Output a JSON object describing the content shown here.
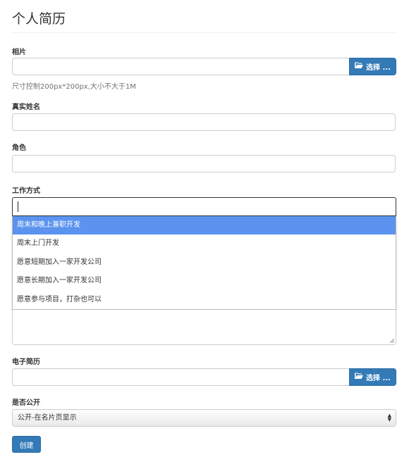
{
  "page": {
    "title": "个人简历"
  },
  "photo": {
    "label": "相片",
    "browse_label": "选择 ...",
    "help": "尺寸控制200px*200px,大小不大于1M"
  },
  "real_name": {
    "label": "真实姓名",
    "value": ""
  },
  "role": {
    "label": "角色",
    "value": ""
  },
  "work_mode": {
    "label": "工作方式",
    "value": "",
    "options": [
      "周末和晚上兼职开发",
      "周末上门开发",
      "愿意短期加入一家开发公司",
      "愿意长期加入一家开发公司",
      "愿意参与项目，打杂也可以"
    ],
    "highlighted_index": 0
  },
  "resume": {
    "label": "电子简历",
    "browse_label": "选择 ..."
  },
  "public": {
    "label": "是否公开",
    "selected": "公开-在名片页显示"
  },
  "actions": {
    "create_label": "创建"
  },
  "colors": {
    "primary": "#337ab7",
    "highlight": "#5b93ef"
  }
}
